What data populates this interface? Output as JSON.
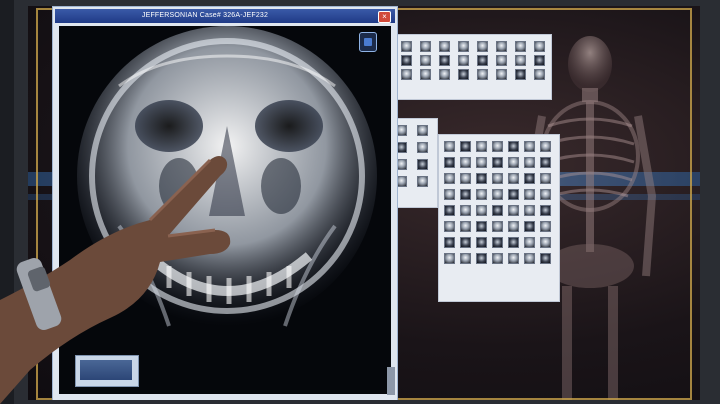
{
  "xray_window": {
    "title": "JEFFERSONIAN Case# 326A-JEF232",
    "close_label": "×"
  },
  "icons": {
    "close": "close-icon",
    "corner": "window-toggle-icon",
    "skull": "skull-xray-icon"
  },
  "colors": {
    "titlebar": "#1f3a86",
    "frame_accent": "#c9a24a",
    "close": "#d14a3a"
  }
}
